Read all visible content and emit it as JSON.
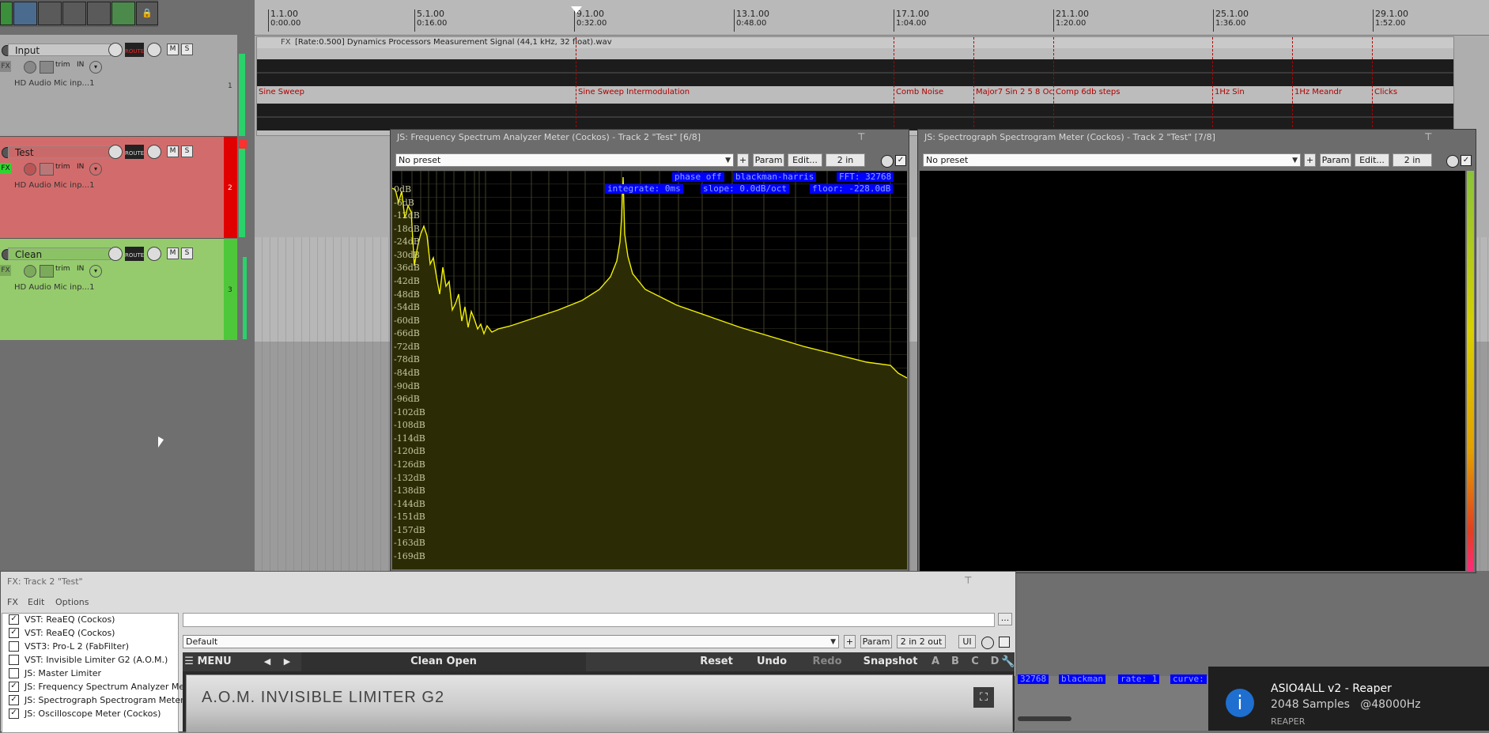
{
  "toolbar": {
    "icons": [
      "envelope-icon",
      "grid-snap-icon",
      "ripple-edit-icon",
      "auto-crossfade-icon",
      "metronome-icon",
      "loop-icon",
      "lock-icon"
    ]
  },
  "ruler": {
    "marks": [
      {
        "bar": "1.1.00",
        "time": "0:00.00"
      },
      {
        "bar": "5.1.00",
        "time": "0:16.00"
      },
      {
        "bar": "9.1.00",
        "time": "0:32.00"
      },
      {
        "bar": "13.1.00",
        "time": "0:48.00"
      },
      {
        "bar": "17.1.00",
        "time": "1:04.00"
      },
      {
        "bar": "21.1.00",
        "time": "1:20.00"
      },
      {
        "bar": "25.1.00",
        "time": "1:36.00"
      },
      {
        "bar": "29.1.00",
        "time": "1:52.00"
      }
    ]
  },
  "tracks": [
    {
      "name": "Input",
      "number": "1",
      "input": "HD Audio Mic inp...1",
      "trim": "trim",
      "in": "IN",
      "color": "#a8a8a8"
    },
    {
      "name": "Test",
      "number": "2",
      "input": "HD Audio Mic inp...1",
      "trim": "trim",
      "in": "IN",
      "color": "#d46c6c"
    },
    {
      "name": "Clean",
      "number": "3",
      "input": "HD Audio Mic inp...1",
      "trim": "trim",
      "in": "IN",
      "color": "#96cc6e"
    }
  ],
  "track_buttons": {
    "mute": "M",
    "solo": "S",
    "route": "ROUTE",
    "fx": "FX"
  },
  "media_item": {
    "title": "[Rate:0.500] Dynamics Processors Measurement Signal (44,1 kHz, 32 float).wav",
    "fx_label": "FX",
    "labels": [
      "Sine Sweep",
      "Sine Sweep Intermodulation",
      "Comb Noise",
      "Major7 Sin 2 5 8 Oc",
      "Comp 6db steps",
      "1Hz Sin",
      "1Hz Meandr",
      "Clicks"
    ]
  },
  "spectrum": {
    "title": "JS: Frequency Spectrum Analyzer Meter (Cockos) - Track 2 \"Test\" [6/8]",
    "preset": "No preset",
    "add": "+",
    "param": "Param",
    "edit": "Edit...",
    "io": "2 in",
    "tags_row1": [
      "phase off",
      "blackman-harris",
      "FFT: 32768"
    ],
    "tags_row2": [
      "integrate: 0ms",
      "slope: 0.0dB/oct",
      "floor: -228.0dB"
    ],
    "db_labels": [
      "0dB",
      "-6dB",
      "-12dB",
      "-18dB",
      "-24dB",
      "-30dB",
      "-36dB",
      "-42dB",
      "-48dB",
      "-54dB",
      "-60dB",
      "-66dB",
      "-72dB",
      "-78dB",
      "-84dB",
      "-90dB",
      "-96dB",
      "-102dB",
      "-108dB",
      "-114dB",
      "-120dB",
      "-126dB",
      "-132dB",
      "-138dB",
      "-144dB",
      "-151dB",
      "-157dB",
      "-163dB",
      "-169dB"
    ],
    "colors": {
      "trace": "#f0f000",
      "fill": "#2a2a00",
      "grid": "#5a5a3a"
    }
  },
  "spectrograph": {
    "title": "JS: Spectrograph Spectrogram Meter (Cockos) - Track 2 \"Test\" [7/8]",
    "preset": "No preset",
    "add": "+",
    "param": "Param",
    "edit": "Edit...",
    "io": "2 in",
    "tags": [
      "32768",
      "blackman",
      "rate: 1",
      "curve:"
    ]
  },
  "fx_chain": {
    "title": "FX: Track 2 \"Test\"",
    "menu": [
      "FX",
      "Edit",
      "Options"
    ],
    "items": [
      {
        "label": "VST: ReaEQ (Cockos)",
        "checked": true
      },
      {
        "label": "VST: ReaEQ (Cockos)",
        "checked": true
      },
      {
        "label": "VST3: Pro-L 2 (FabFilter)",
        "checked": false
      },
      {
        "label": "VST: Invisible Limiter G2 (A.O.M.)",
        "checked": false
      },
      {
        "label": "JS: Master Limiter",
        "checked": false
      },
      {
        "label": "JS: Frequency Spectrum Analyzer Met...",
        "checked": true
      },
      {
        "label": "JS: Spectrograph Spectrogram Meter ...",
        "checked": true
      },
      {
        "label": "JS: Oscilloscope Meter (Cockos)",
        "checked": true
      }
    ],
    "browse": "...",
    "preset": "Default",
    "add": "+",
    "param": "Param",
    "io": "2 in 2 out",
    "ui": "UI",
    "plugin": {
      "menu": "MENU",
      "preset_name": "Clean Open",
      "reset": "Reset",
      "undo": "Undo",
      "redo": "Redo",
      "snapshot": "Snapshot",
      "slots": [
        "A",
        "B",
        "C",
        "D"
      ],
      "brand": "A.O.M. INVISIBLE LIMITER G2"
    }
  },
  "toast": {
    "title": "ASIO4ALL v2 - Reaper",
    "line": "2048 Samples   @48000Hz",
    "app": "REAPER",
    "icon": "i"
  }
}
